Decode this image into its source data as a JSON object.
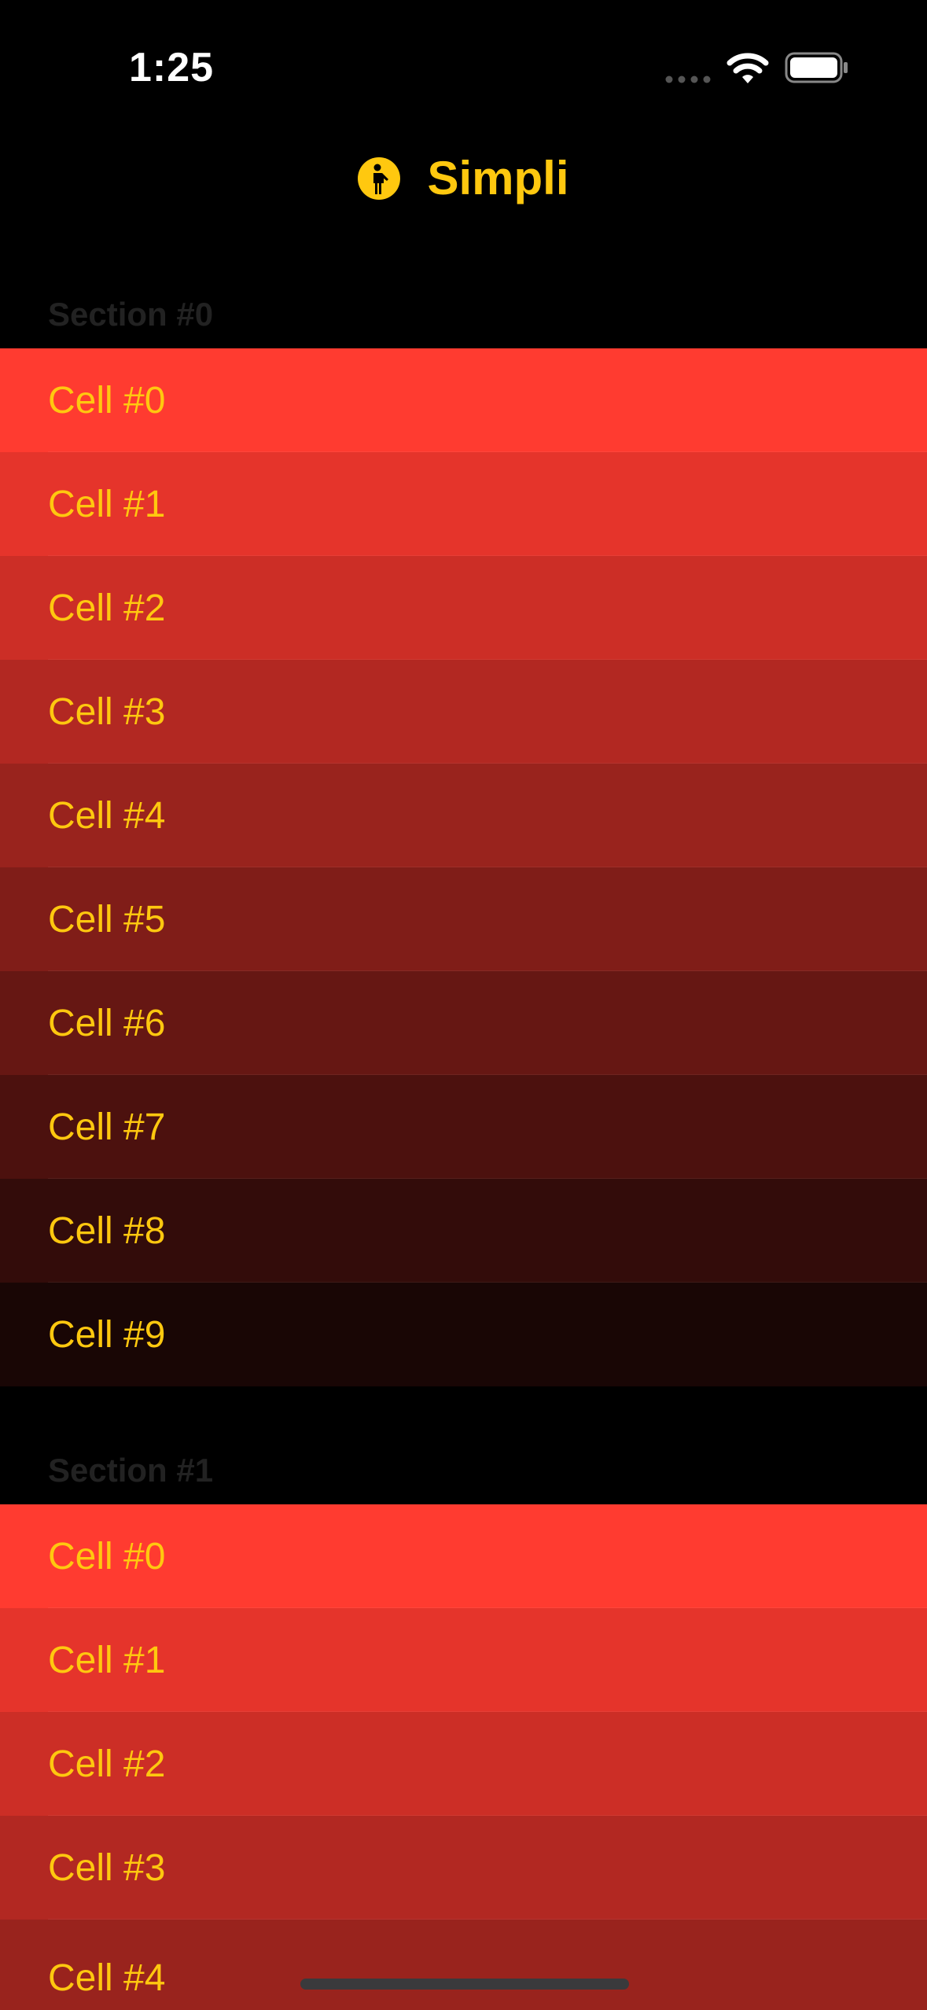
{
  "status_bar": {
    "time": "1:25",
    "icons": [
      "signal-dots-icon",
      "wifi-icon",
      "battery-icon"
    ]
  },
  "nav": {
    "title": "Simpli",
    "logo_icon": "person-standing-circle-icon"
  },
  "colors": {
    "accent": "#FFC80F",
    "background": "#000000",
    "section_header": "#222222",
    "row_gradient": [
      "#FF3B30",
      "#E5342B",
      "#CC2E26",
      "#B22822",
      "#99231D",
      "#801D18",
      "#661713",
      "#4C110E",
      "#330C0A",
      "#190605"
    ]
  },
  "sections": [
    {
      "header": "Section #0",
      "cells": [
        "Cell #0",
        "Cell #1",
        "Cell #2",
        "Cell #3",
        "Cell #4",
        "Cell #5",
        "Cell #6",
        "Cell #7",
        "Cell #8",
        "Cell #9"
      ]
    },
    {
      "header": "Section #1",
      "cells": [
        "Cell #0",
        "Cell #1",
        "Cell #2",
        "Cell #3",
        "Cell #4"
      ]
    }
  ]
}
